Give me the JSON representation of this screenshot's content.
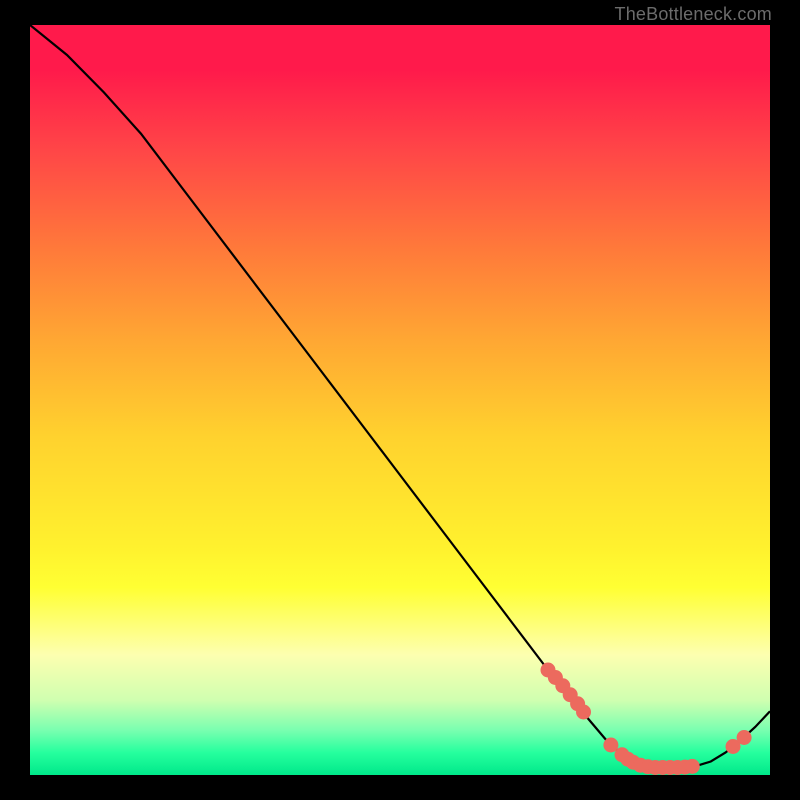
{
  "attribution": "TheBottleneck.com",
  "colors": {
    "curve": "#000000",
    "marker_fill": "#ec6a5e",
    "marker_stroke": "#ec6a5e",
    "background": "#000000"
  },
  "chart_data": {
    "type": "line",
    "title": "",
    "xlabel": "",
    "ylabel": "",
    "xlim": [
      0,
      100
    ],
    "ylim": [
      0,
      100
    ],
    "grid": false,
    "curve": {
      "x": [
        0,
        5,
        10,
        15,
        20,
        25,
        30,
        35,
        40,
        45,
        50,
        55,
        60,
        65,
        70,
        75,
        78,
        80,
        82,
        85,
        88,
        90,
        92,
        94,
        96,
        98,
        100
      ],
      "y": [
        100,
        96,
        91,
        85.5,
        79,
        72.5,
        66,
        59.5,
        53,
        46.5,
        40,
        33.5,
        27,
        20.5,
        14,
        8,
        4.5,
        2.7,
        1.6,
        1.0,
        1.0,
        1.2,
        1.8,
        3.0,
        4.6,
        6.4,
        8.5
      ]
    },
    "markers": [
      {
        "x": 70.0,
        "y": 14.0
      },
      {
        "x": 71.0,
        "y": 13.0
      },
      {
        "x": 72.0,
        "y": 11.9
      },
      {
        "x": 73.0,
        "y": 10.7
      },
      {
        "x": 74.0,
        "y": 9.5
      },
      {
        "x": 74.8,
        "y": 8.4
      },
      {
        "x": 78.5,
        "y": 4.0
      },
      {
        "x": 80.0,
        "y": 2.7
      },
      {
        "x": 80.8,
        "y": 2.1
      },
      {
        "x": 81.5,
        "y": 1.7
      },
      {
        "x": 82.5,
        "y": 1.3
      },
      {
        "x": 83.5,
        "y": 1.1
      },
      {
        "x": 84.5,
        "y": 1.0
      },
      {
        "x": 85.5,
        "y": 1.0
      },
      {
        "x": 86.5,
        "y": 1.0
      },
      {
        "x": 87.5,
        "y": 1.0
      },
      {
        "x": 88.5,
        "y": 1.05
      },
      {
        "x": 89.5,
        "y": 1.15
      },
      {
        "x": 95.0,
        "y": 3.8
      },
      {
        "x": 96.5,
        "y": 5.0
      }
    ],
    "marker_radius_px": 7
  }
}
